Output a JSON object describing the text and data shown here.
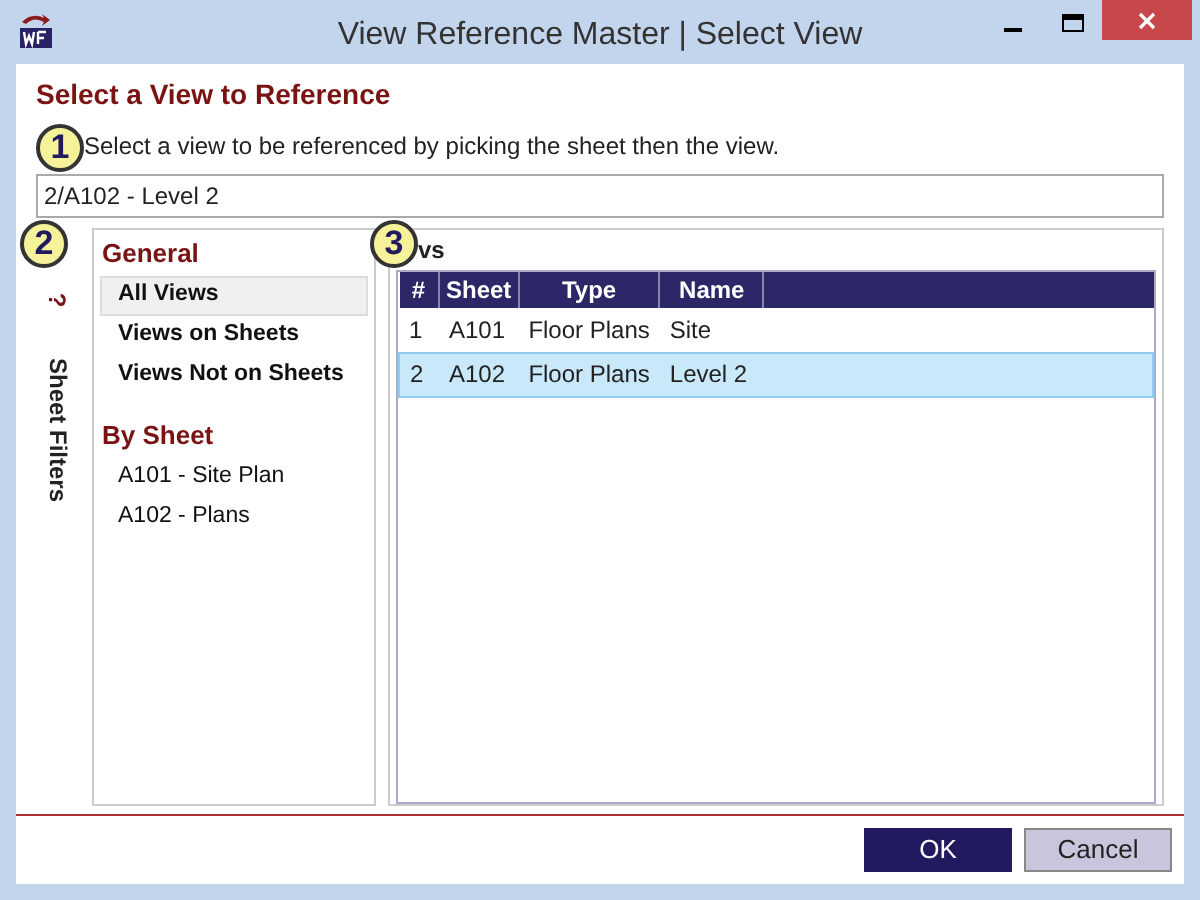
{
  "window": {
    "title": "View Reference Master | Select View"
  },
  "heading": "Select a View to Reference",
  "callouts": [
    "1",
    "2",
    "3"
  ],
  "instruction": "Select a view to be referenced by picking the sheet then the view.",
  "selection_field": {
    "value": "2/A102 - Level 2"
  },
  "side_tab": {
    "label": "Sheet Filters",
    "icon_text": "?"
  },
  "filters": [
    {
      "title": "General",
      "items": [
        {
          "label": "All Views",
          "bold": true,
          "selected": true
        },
        {
          "label": "Views on Sheets",
          "bold": true,
          "selected": false
        },
        {
          "label": "Views Not on Sheets",
          "bold": true,
          "selected": false
        }
      ]
    },
    {
      "title": "By Sheet",
      "items": [
        {
          "label": "A101 - Site Plan",
          "bold": false,
          "selected": false
        },
        {
          "label": "A102 - Plans",
          "bold": false,
          "selected": false
        }
      ]
    }
  ],
  "views_heading": "vs",
  "table": {
    "columns": [
      "#",
      "Sheet",
      "Type",
      "Name"
    ],
    "rows": [
      {
        "cells": [
          "1",
          "A101",
          "Floor Plans",
          "Site"
        ],
        "selected": false
      },
      {
        "cells": [
          "2",
          "A102",
          "Floor Plans",
          "Level 2"
        ],
        "selected": true
      }
    ]
  },
  "buttons": [
    {
      "label": "OK",
      "kind": "primary"
    },
    {
      "label": "Cancel",
      "kind": "secondary"
    }
  ]
}
